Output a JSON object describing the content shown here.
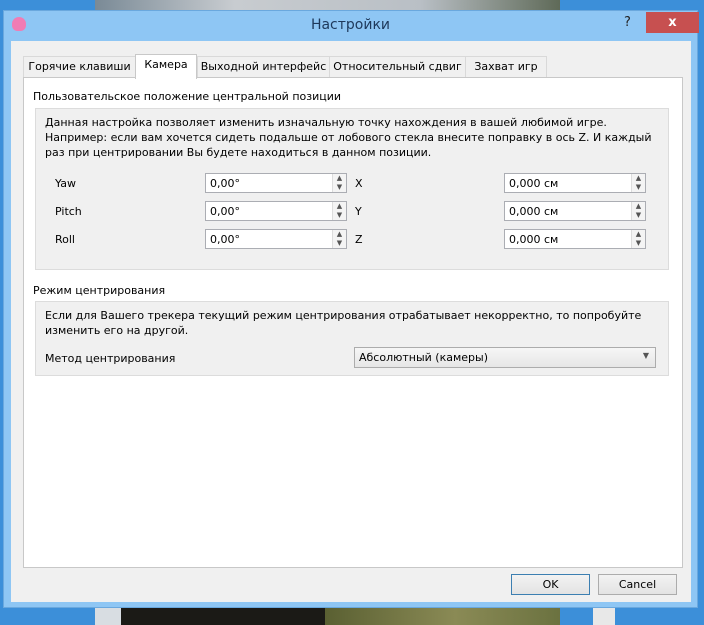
{
  "window": {
    "title": "Настройки",
    "help": "?",
    "close": "x"
  },
  "tabs": [
    "Горячие клавиши",
    "Камера",
    "Выходной интерфейс",
    "Относительный сдвиг",
    "Захват игр"
  ],
  "camera": {
    "group_title": "Пользовательское положение центральной позиции",
    "description": "Данная настройка позволяет изменить изначальную точку нахождения в вашей любимой игре. Например: если вам хочется сидеть подальше от лобового стекла внесите поправку в ось Z. И каждый раз при центрировании Вы будете находиться в данном позиции.",
    "rows": [
      {
        "label": "Yaw",
        "value": "0,00°",
        "axis": "X",
        "offset": "0,000 см"
      },
      {
        "label": "Pitch",
        "value": "0,00°",
        "axis": "Y",
        "offset": "0,000 см"
      },
      {
        "label": "Roll",
        "value": "0,00°",
        "axis": "Z",
        "offset": "0,000 см"
      }
    ]
  },
  "centering": {
    "group_title": "Режим центрирования",
    "description": "Если для Вашего трекера текущий режим центрирования отрабатывает некорректно, то попробуйте изменить его на другой.",
    "method_label": "Метод центрирования",
    "method_value": "Абсолютный (камеры)"
  },
  "buttons": {
    "ok": "OK",
    "cancel": "Cancel"
  }
}
